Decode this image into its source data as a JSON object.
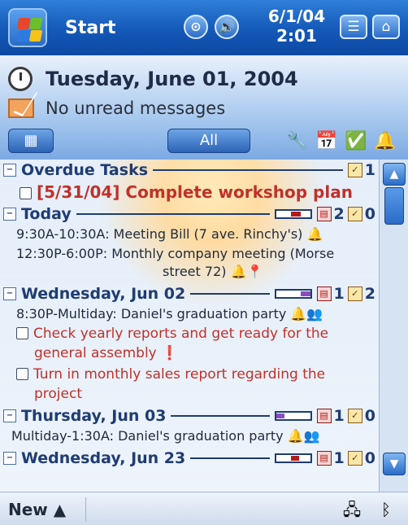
{
  "titlebar": {
    "start_label": "Start",
    "date": "6/1/04",
    "time": "2:01"
  },
  "header": {
    "date": "Tuesday, June 01, 2004",
    "messages": "No unread messages"
  },
  "toolbar": {
    "filter_label": "All"
  },
  "list": {
    "overdue": {
      "title": "Overdue Tasks",
      "task_count": "1",
      "item": "[5/31/04] Complete workshop plan"
    },
    "today": {
      "title": "Today",
      "appt_count": "2",
      "task_count": "0",
      "items": [
        "9:30A-10:30A: Meeting Bill (7 ave. Rinchy's)",
        "12:30P-6:00P: Monthly company meeting (Morse",
        "street 72)"
      ]
    },
    "wed": {
      "title": "Wednesday, Jun 02",
      "appt_count": "1",
      "task_count": "2",
      "appt": "8:30P-Multiday: Daniel's graduation party",
      "task1_line1": "Check yearly reports and get ready for the",
      "task1_line2": "general assembly",
      "task2_line1": "Turn in monthly sales report regarding the",
      "task2_line2": "project"
    },
    "thu": {
      "title": "Thursday, Jun 03",
      "appt_count": "1",
      "task_count": "0",
      "appt": "Multiday-1:30A: Daniel's graduation party"
    },
    "wed2": {
      "title": "Wednesday, Jun 23",
      "appt_count": "1",
      "task_count": "0"
    }
  },
  "bottom": {
    "new_label": "New"
  }
}
